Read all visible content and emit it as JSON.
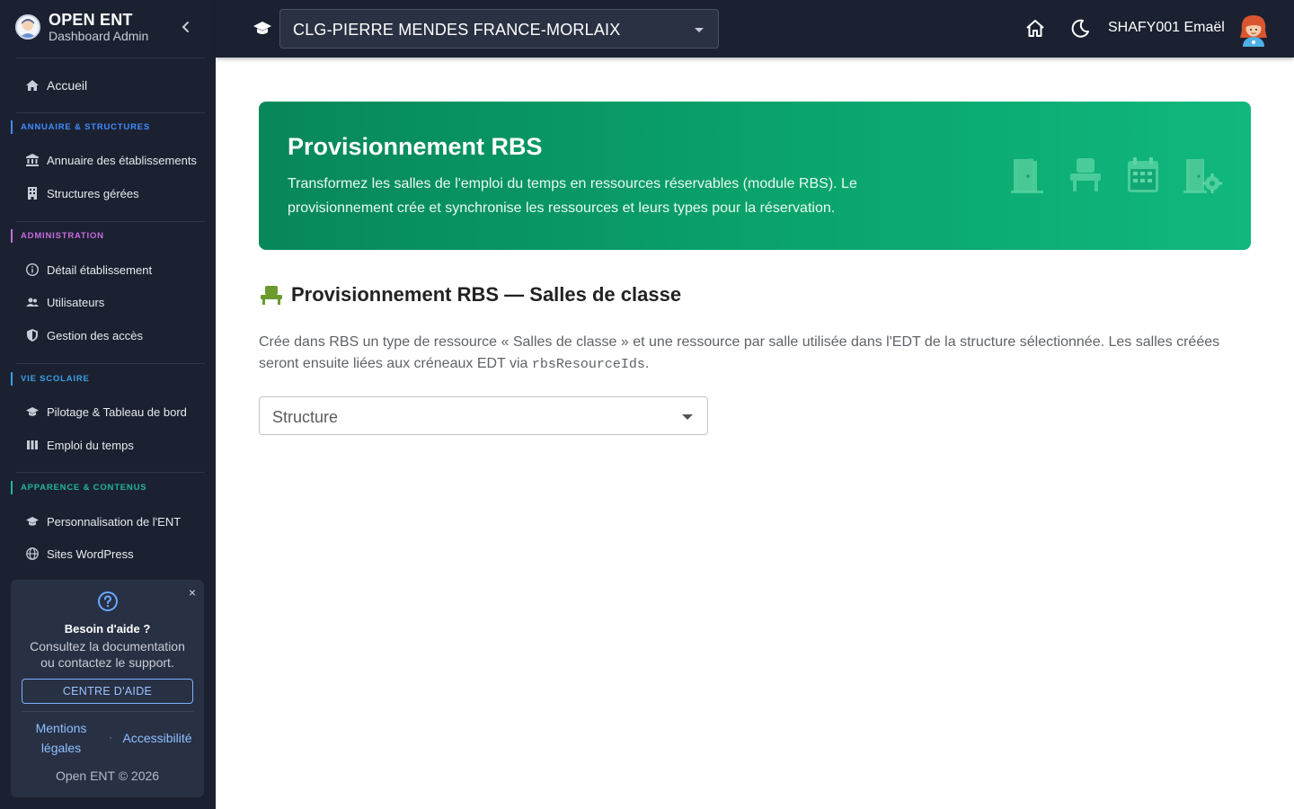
{
  "sidebar": {
    "brand_title": "OPEN ENT",
    "brand_subtitle": "Dashboard Admin",
    "home_label": "Accueil",
    "sections": [
      {
        "label": "ANNUAIRE & STRUCTURES",
        "color": "#3f8cff",
        "items": [
          {
            "label": "Annuaire des établissements",
            "icon": "institution-icon"
          },
          {
            "label": "Structures gérées",
            "icon": "building-icon"
          }
        ]
      },
      {
        "label": "ADMINISTRATION",
        "color": "#c86be0",
        "items": [
          {
            "label": "Détail établissement",
            "icon": "info-icon"
          },
          {
            "label": "Utilisateurs",
            "icon": "users-icon"
          },
          {
            "label": "Gestion des accès",
            "icon": "shield-icon"
          }
        ]
      },
      {
        "label": "VIE SCOLAIRE",
        "color": "#3aa0e8",
        "items": [
          {
            "label": "Pilotage & Tableau de bord",
            "icon": "graduation-cap-icon"
          },
          {
            "label": "Emploi du temps",
            "icon": "columns-icon"
          }
        ]
      },
      {
        "label": "APPARENCE & CONTENUS",
        "color": "#22b59a",
        "items": [
          {
            "label": "Personnalisation de l'ENT",
            "icon": "graduation-cap-icon"
          },
          {
            "label": "Sites WordPress",
            "icon": "globe-icon"
          }
        ]
      }
    ],
    "help": {
      "title": "Besoin d'aide ?",
      "text": "Consultez la documentation ou contactez le support.",
      "button": "CENTRE D'AIDE",
      "link_legal": "Mentions légales",
      "separator": "·",
      "link_access": "Accessibilité",
      "copyright": "Open ENT © 2026",
      "close": "×"
    }
  },
  "topbar": {
    "school": "CLG-PIERRE MENDES FRANCE-MORLAIX",
    "username": "SHAFY001 Emaël"
  },
  "banner": {
    "title": "Provisionnement RBS",
    "text": "Transformez les salles de l'emploi du temps en ressources réservables (module RBS). Le provisionnement crée et synchronise les ressources et leurs types pour la réservation.",
    "icons": [
      "door-icon",
      "seat-icon",
      "calendar-icon",
      "door-gear-icon"
    ]
  },
  "section": {
    "title": "Provisionnement RBS — Salles de classe",
    "desc_before": "Crée dans RBS un type de ressource « Salles de classe » et une ressource par salle utilisée dans l'EDT de la structure sélectionnée. Les salles créées seront ensuite liées aux créneaux EDT via ",
    "desc_code": "rbsResourceIds",
    "desc_after": "."
  },
  "structure_select": {
    "placeholder": "Structure"
  },
  "colors": {
    "sidebar_bg": "#1b2130",
    "banner_start": "#07875a",
    "banner_end": "#10b87d",
    "seat_icon": "#6a9a2e"
  }
}
